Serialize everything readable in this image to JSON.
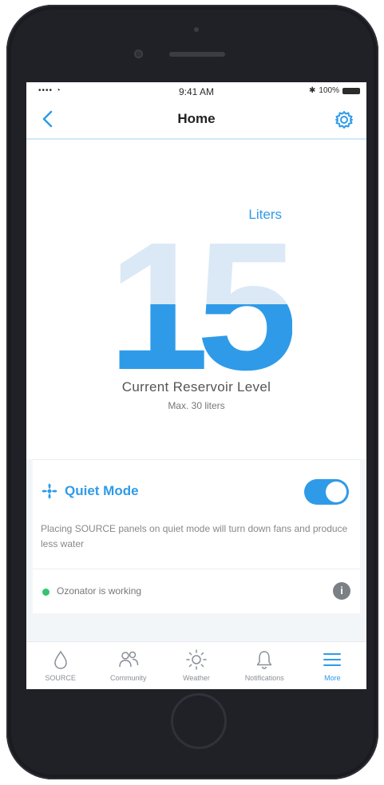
{
  "status_bar": {
    "signal": "•••• ◔",
    "time": "9:41 AM",
    "battery_text": "100%"
  },
  "nav": {
    "title": "Home"
  },
  "reservoir": {
    "value": "15",
    "unit": "Liters",
    "caption": "Current Reservoir Level",
    "sub": "Max. 30 liters",
    "fill_fraction": 0.5
  },
  "quiet_mode": {
    "title": "Quiet Mode",
    "description": "Placing SOURCE panels on quiet mode will turn down fans and produce less water",
    "enabled": true
  },
  "ozonator": {
    "status_text": "Ozonator is working",
    "info_icon": "i"
  },
  "tabs": [
    {
      "label": "SOURCE",
      "icon": "drop-icon",
      "active": false
    },
    {
      "label": "Community",
      "icon": "people-icon",
      "active": false
    },
    {
      "label": "Weather",
      "icon": "sun-icon",
      "active": false
    },
    {
      "label": "Notifications",
      "icon": "bell-icon",
      "active": false
    },
    {
      "label": "More",
      "icon": "menu-icon",
      "active": true
    }
  ],
  "colors": {
    "accent": "#2f9be8",
    "status_ok": "#33c56e",
    "level_light": "#dbe9f6"
  }
}
